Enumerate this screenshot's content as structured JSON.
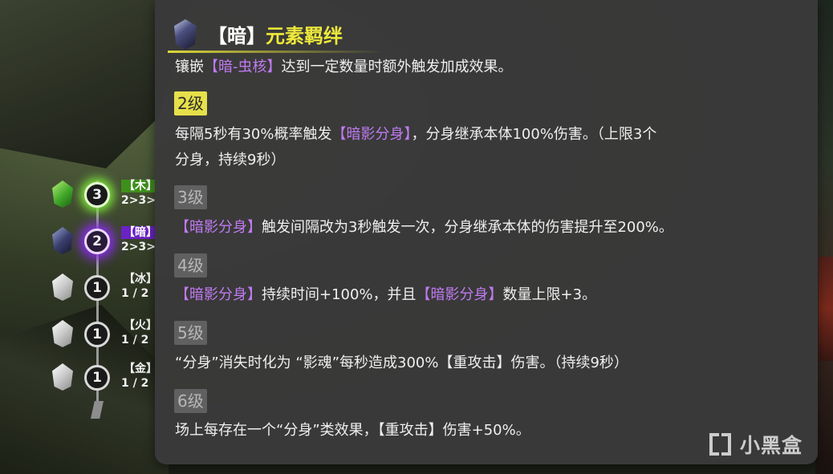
{
  "tracker": {
    "rows": [
      {
        "count": "3",
        "label_top": "【木】",
        "label_bottom": "2>3>"
      },
      {
        "count": "2",
        "label_top": "【暗】",
        "label_bottom": "2>3>"
      },
      {
        "count": "1",
        "label_top": "【冰】",
        "label_bottom": "1 / 2"
      },
      {
        "count": "1",
        "label_top": "【火】",
        "label_bottom": "1 / 2"
      },
      {
        "count": "1",
        "label_top": "【金】",
        "label_bottom": "1 / 2"
      }
    ]
  },
  "tooltip": {
    "title_bracket": "【暗】",
    "title_name": "元素羁绊",
    "desc": {
      "p1": "镶嵌",
      "hl": "【暗-虫核】",
      "p2": "达到一定数量时额外触发加成效果。"
    },
    "levels": [
      {
        "label": "2级",
        "line1_p1": "每隔5秒有30%概率触发",
        "line1_hl": "【暗影分身】",
        "line1_p2": "，分身继承本体100%伤害。（上限3个",
        "line2": "分身，持续9秒）"
      },
      {
        "label": "3级",
        "hl": "【暗影分身】",
        "text": "触发间隔改为3秒触发一次，分身继承本体的伤害提升至200%。"
      },
      {
        "label": "4级",
        "hl1": "【暗影分身】",
        "text1": "持续时间+100%，并且",
        "hl2": "【暗影分身】",
        "text2": "数量上限+3。"
      },
      {
        "label": "5级",
        "text": "“分身”消失时化为 “影魂”每秒造成300%【重攻击】伤害。（持续9秒）"
      },
      {
        "label": "6级",
        "text": "场上每存在一个“分身”类效果，【重攻击】伤害+50%。"
      }
    ]
  },
  "watermark": {
    "text": "小黑盒"
  },
  "colors": {
    "title_yellow": "#eee93a",
    "highlight_purple": "#c07af2",
    "active_level_bg": "#e6e04a",
    "inactive_level_bg": "#606060",
    "panel_bg": "#3a3a3a"
  }
}
